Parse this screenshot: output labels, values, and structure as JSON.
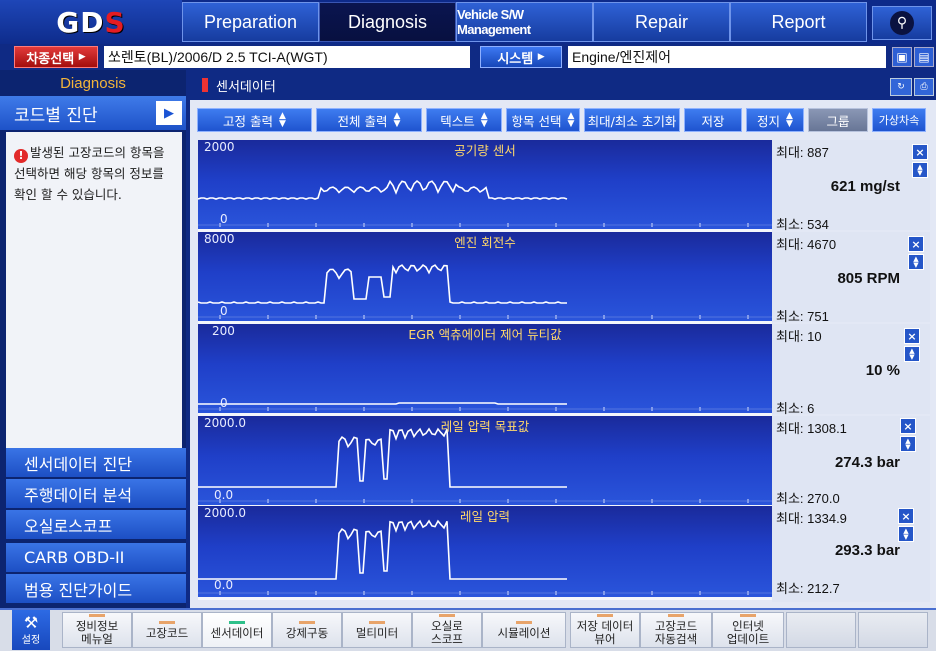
{
  "logo": {
    "text": "GDS"
  },
  "nav": {
    "tabs": [
      {
        "label": "Preparation"
      },
      {
        "label": "Diagnosis"
      },
      {
        "label": "Vehicle S/W Management"
      },
      {
        "label": "Repair"
      },
      {
        "label": "Report"
      }
    ],
    "active": "Diagnosis"
  },
  "vehicle": {
    "select_label": "차종선택",
    "value": "쏘렌토(BL)/2006/D 2.5 TCI-A(WGT)",
    "system_label": "시스템",
    "system_value": "Engine/엔진제어"
  },
  "sidebar": {
    "title": "Diagnosis",
    "section": "코드별 진단",
    "message": "발생된 고장코드의 항목을 선택하면 해당 항목의 정보를 확인 할 수 있습니다.",
    "menu": [
      {
        "label": "센서데이터 진단"
      },
      {
        "label": "주행데이터 분석"
      },
      {
        "label": "오실로스코프"
      },
      {
        "label": "CARB OBD-II"
      },
      {
        "label": "범용 진단가이드"
      }
    ]
  },
  "main": {
    "title": "센서데이터",
    "toolbar": [
      {
        "label": "고정 출력",
        "updown": true
      },
      {
        "label": "전체 출력",
        "updown": true
      },
      {
        "label": "텍스트",
        "updown": true
      },
      {
        "label": "항목 선택",
        "updown": true
      },
      {
        "label": "최대/최소 초기화",
        "updown": false
      },
      {
        "label": "저장",
        "updown": false
      },
      {
        "label": "정지",
        "updown": true
      },
      {
        "label": "그룹",
        "updown": false
      },
      {
        "label": "가상차속",
        "updown": false
      }
    ]
  },
  "graphs": [
    {
      "name": "공기량 센서",
      "scale_max": "2000",
      "scale_min": "0",
      "max_label": "최대: 887",
      "min_label": "최소: 534",
      "current": "621 mg/st",
      "trace": "air"
    },
    {
      "name": "엔진 회전수",
      "scale_max": "8000",
      "scale_min": "0",
      "max_label": "최대: 4670",
      "min_label": "최소: 751",
      "current": "805 RPM",
      "trace": "rpm"
    },
    {
      "name": "EGR 액츄에이터 제어 듀티값",
      "scale_max": "200",
      "scale_min": "0",
      "max_label": "최대: 10",
      "min_label": "최소: 6",
      "current": "10 %",
      "trace": "egr"
    },
    {
      "name": "레일 압력 목표값",
      "scale_max": "2000.0",
      "scale_min": "0.0",
      "max_label": "최대: 1308.1",
      "min_label": "최소: 270.0",
      "current": "274.3 bar",
      "trace": "rail"
    },
    {
      "name": "레일 압력",
      "scale_max": "2000.0",
      "scale_min": "0.0",
      "max_label": "최대: 1334.9",
      "min_label": "최소: 212.7",
      "current": "293.3 bar",
      "trace": "rail"
    }
  ],
  "bottom": {
    "settings_label": "설정",
    "tabs": [
      {
        "line1": "정비정보",
        "line2": "메뉴얼"
      },
      {
        "line1": "고장코드",
        "line2": ""
      },
      {
        "line1": "센서데이터",
        "line2": ""
      },
      {
        "line1": "강제구동",
        "line2": ""
      },
      {
        "line1": "멀티미터",
        "line2": ""
      },
      {
        "line1": "오실로",
        "line2": "스코프"
      },
      {
        "line1": "시뮬레이션",
        "line2": ""
      },
      {
        "line1": "저장 데이터",
        "line2": "뷰어"
      },
      {
        "line1": "고장코드",
        "line2": "자동검색"
      },
      {
        "line1": "인터넷",
        "line2": "업데이트"
      }
    ]
  },
  "colors": {
    "accent_red": "#e51c23",
    "nav_blue": "#1e46b8",
    "graph_trace": "#ffffff",
    "label_yellow": "#ffd86b",
    "sidebar_title": "#f2b43a"
  }
}
